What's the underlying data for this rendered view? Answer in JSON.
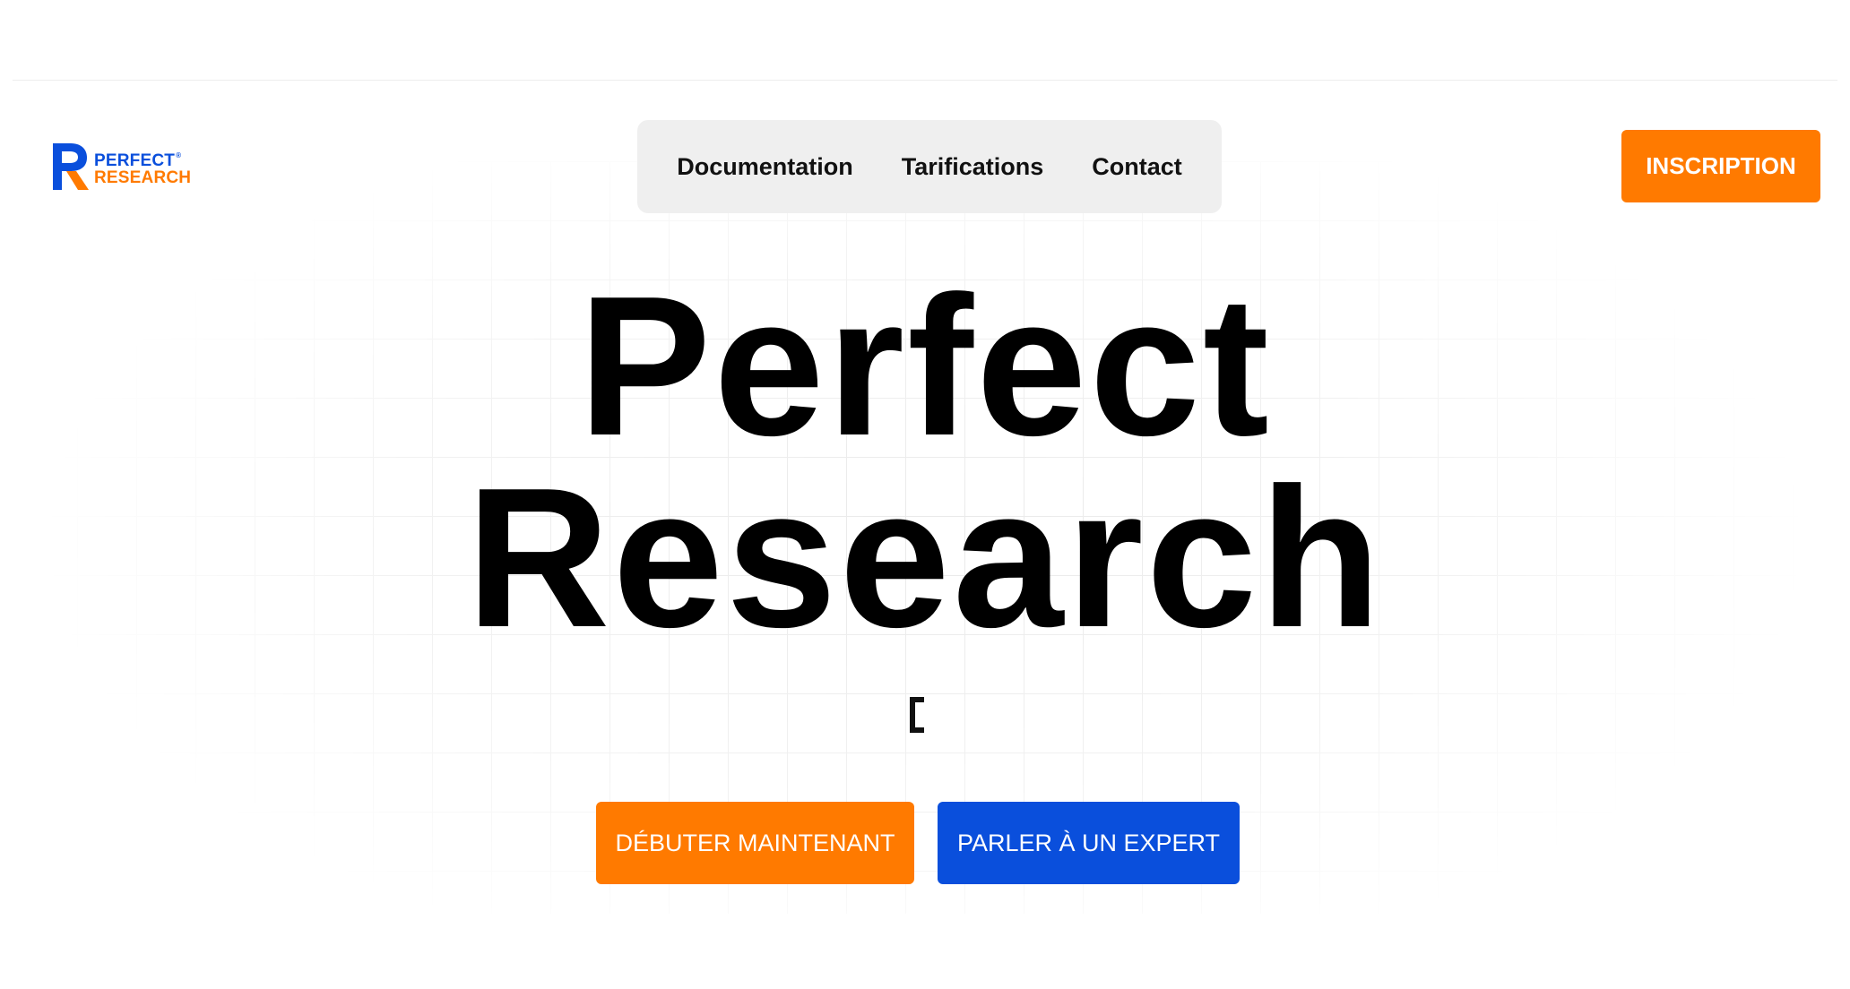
{
  "brand": {
    "logo_line1": "PERFECT",
    "logo_registered": "®",
    "logo_line2": "RESEARCH",
    "logo_icon": "r-monogram-icon",
    "primary_color": "#0a4fdc",
    "accent_color": "#ff7a00"
  },
  "nav": {
    "items": [
      {
        "label": "Documentation"
      },
      {
        "label": "Tarifications"
      },
      {
        "label": "Contact"
      }
    ]
  },
  "header": {
    "signup_label": "INSCRIPTION"
  },
  "hero": {
    "title_line1": "Perfect",
    "title_line2": "Research",
    "typing_cursor_icon": "text-cursor-icon",
    "cta_primary_label": "DÉBUTER MAINTENANT",
    "cta_secondary_label": "PARLER À UN EXPERT"
  }
}
